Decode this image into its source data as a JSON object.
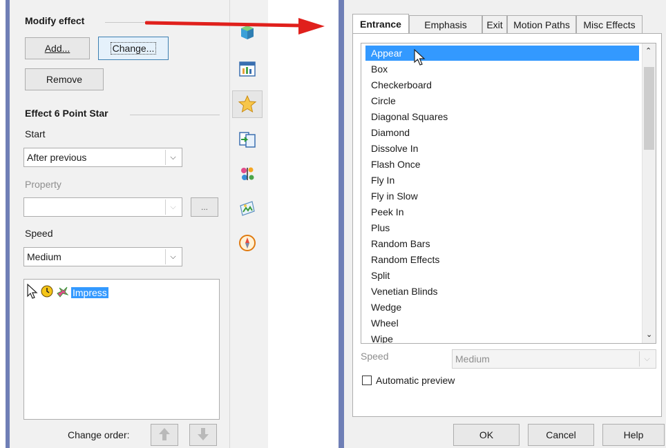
{
  "modify_effect": {
    "heading": "Modify effect",
    "add_button": "Add...",
    "change_button": "Change...",
    "remove_button": "Remove"
  },
  "effect_section": {
    "heading": "Effect 6 Point Star",
    "start_label": "Start",
    "start_value": "After previous",
    "property_label": "Property",
    "property_value": "",
    "property_more_button": "...",
    "speed_label": "Speed",
    "speed_value": "Medium",
    "effect_item_label": "Impress",
    "change_order_label": "Change order:"
  },
  "sidebar_icons": [
    "properties-icon",
    "layouts-icon",
    "custom-animation-icon",
    "slide-transition-icon",
    "styles-icon",
    "gallery-icon",
    "navigator-icon"
  ],
  "dialog": {
    "tabs": [
      "Entrance",
      "Emphasis",
      "Exit",
      "Motion Paths",
      "Misc Effects"
    ],
    "active_tab": "Entrance",
    "effects": [
      "Appear",
      "Box",
      "Checkerboard",
      "Circle",
      "Diagonal Squares",
      "Diamond",
      "Dissolve In",
      "Flash Once",
      "Fly In",
      "Fly in Slow",
      "Peek In",
      "Plus",
      "Random Bars",
      "Random Effects",
      "Split",
      "Venetian Blinds",
      "Wedge",
      "Wheel",
      "Wipe"
    ],
    "selected_effect": "Appear",
    "speed_label": "Speed",
    "speed_value": "Medium",
    "automatic_preview_label": "Automatic preview",
    "automatic_preview_checked": false,
    "ok_button": "OK",
    "cancel_button": "Cancel",
    "help_button": "Help"
  },
  "colors": {
    "selection": "#3399ff",
    "annotation_arrow": "#e0201c",
    "window_border": "#6f7fb6"
  }
}
